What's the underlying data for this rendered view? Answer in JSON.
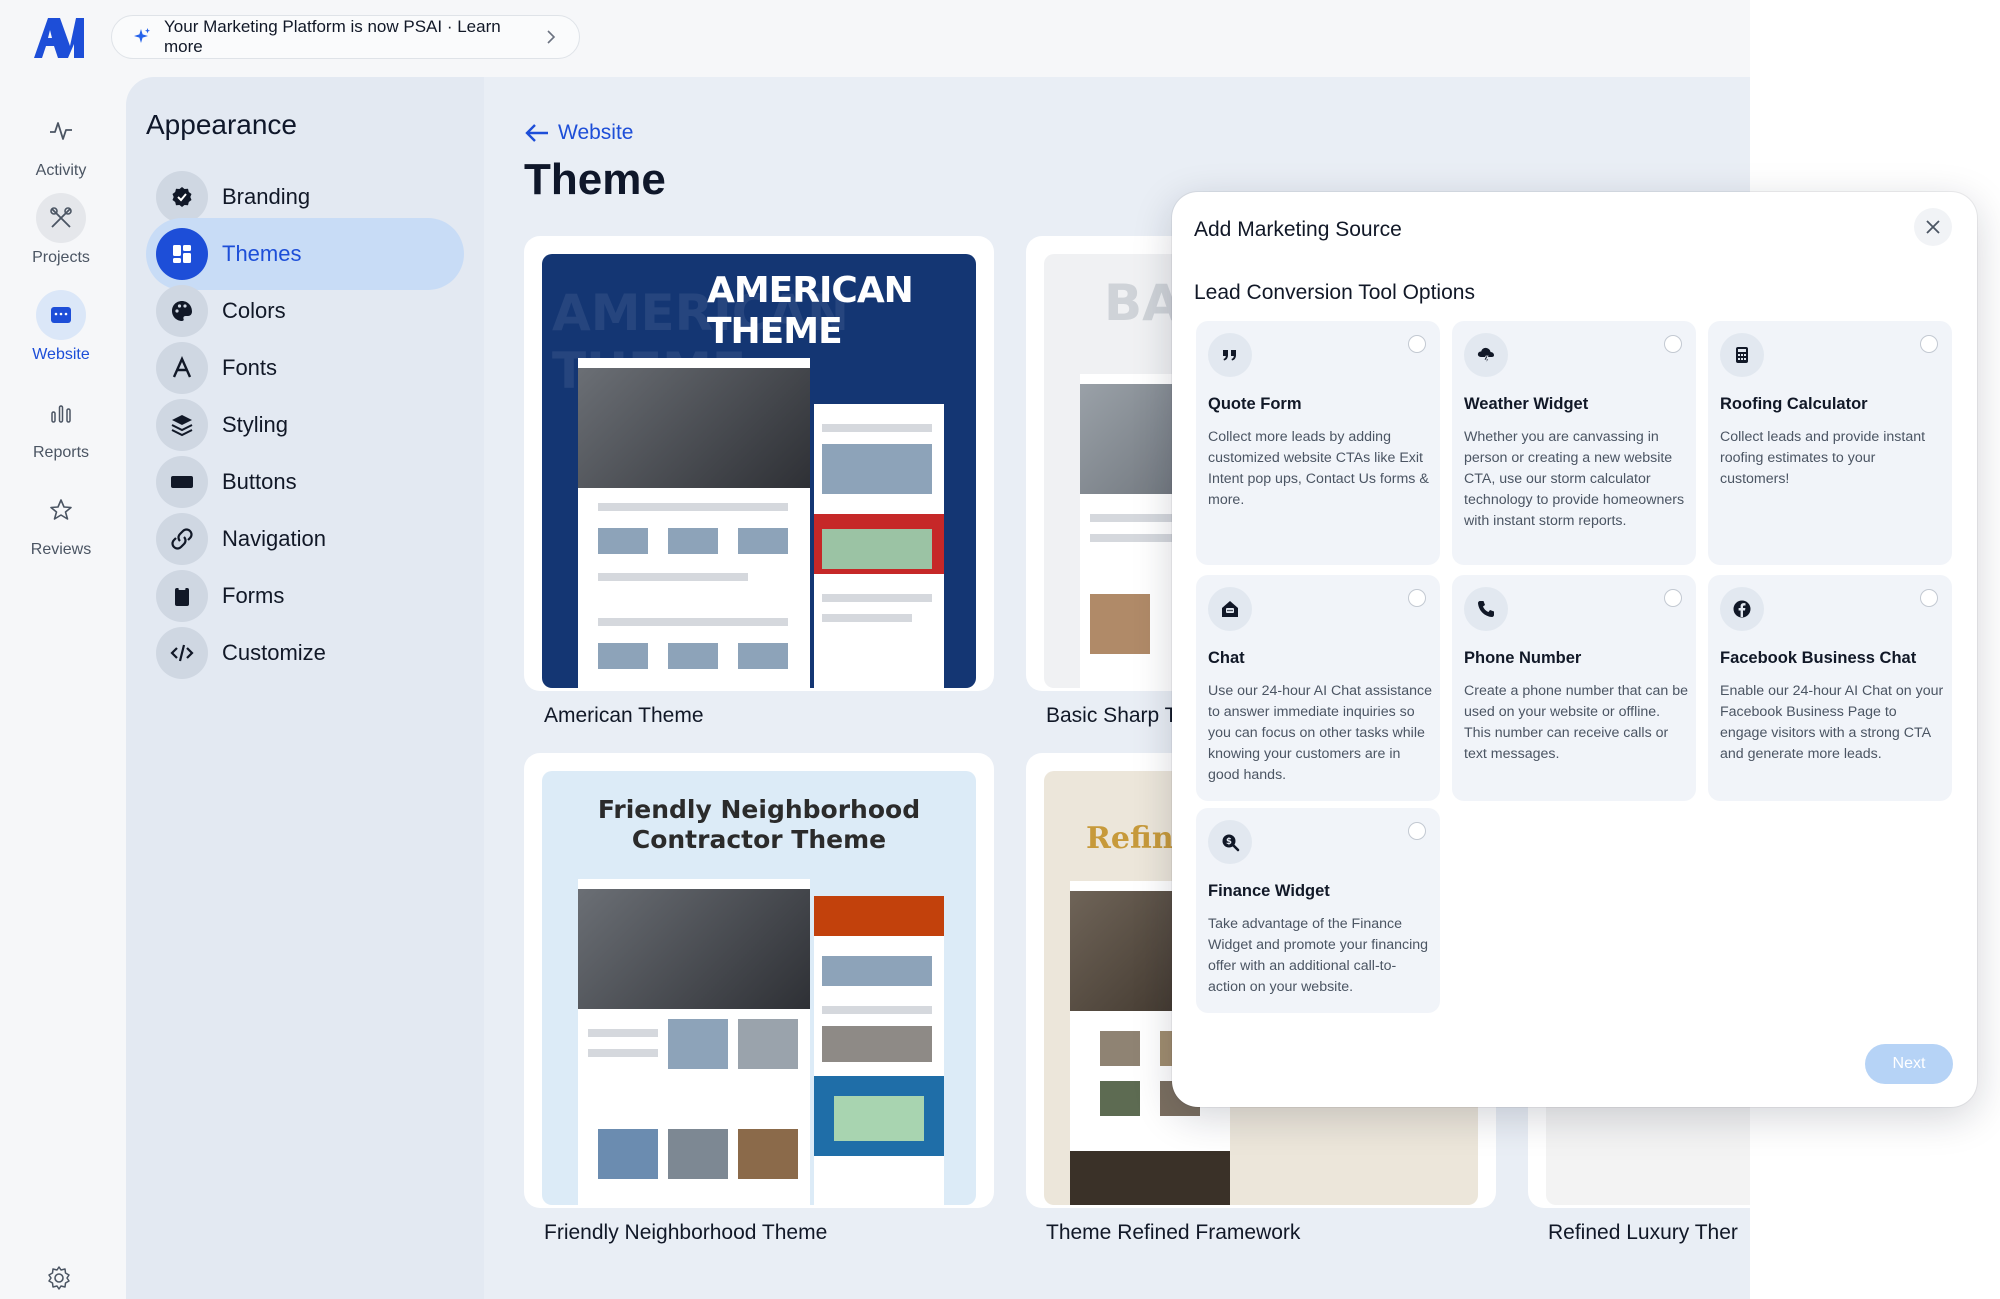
{
  "banner": {
    "text": "Your Marketing Platform is now PSAI · Learn more"
  },
  "rail": {
    "items": [
      {
        "label": "Activity",
        "icon": "activity-icon"
      },
      {
        "label": "Projects",
        "icon": "tools-icon"
      },
      {
        "label": "Website",
        "icon": "browser-icon"
      },
      {
        "label": "Reports",
        "icon": "bar-chart-icon"
      },
      {
        "label": "Reviews",
        "icon": "star-icon"
      }
    ],
    "active": "Website"
  },
  "appearance": {
    "title": "Appearance",
    "items": [
      {
        "label": "Branding",
        "icon": "badge-check-icon"
      },
      {
        "label": "Themes",
        "icon": "layout-icon"
      },
      {
        "label": "Colors",
        "icon": "palette-icon"
      },
      {
        "label": "Fonts",
        "icon": "font-icon"
      },
      {
        "label": "Styling",
        "icon": "layers-icon"
      },
      {
        "label": "Buttons",
        "icon": "button-icon"
      },
      {
        "label": "Navigation",
        "icon": "link-icon"
      },
      {
        "label": "Forms",
        "icon": "clipboard-icon"
      },
      {
        "label": "Customize",
        "icon": "code-icon"
      }
    ],
    "active": "Themes"
  },
  "main": {
    "back_label": "Website",
    "title": "Theme",
    "themes": [
      {
        "label": "American Theme",
        "banner_text": "AMERICAN THEME",
        "ghost_text": "AMERICAN THEME"
      },
      {
        "label": "Basic Sharp T",
        "banner_text": "BA"
      },
      {
        "label": "Friendly Neighborhood Theme",
        "banner_text": "Friendly Neighborhood Contractor Theme"
      },
      {
        "label": "Theme Refined Framework",
        "banner_text": "Refine"
      },
      {
        "label": "Refined Luxury Ther"
      }
    ]
  },
  "modal": {
    "title": "Add Marketing Source",
    "subtitle": "Lead Conversion Tool Options",
    "options": [
      {
        "name": "Quote Form",
        "icon": "quote-icon",
        "desc": "Collect more leads by adding customized website CTAs like Exit Intent pop ups, Contact Us forms & more."
      },
      {
        "name": "Weather Widget",
        "icon": "storm-cloud-icon",
        "desc": "Whether you are canvassing in person or creating a new website CTA, use our storm calculator technology to provide homeowners with instant storm reports."
      },
      {
        "name": "Roofing Calculator",
        "icon": "calculator-icon",
        "desc": "Collect leads and provide instant roofing estimates to your customers!"
      },
      {
        "name": "Chat",
        "icon": "home-chat-icon",
        "desc": "Use our 24-hour AI Chat assistance to answer immediate inquiries so you can focus on other tasks while knowing your customers are in good hands."
      },
      {
        "name": "Phone Number",
        "icon": "phone-icon",
        "desc": "Create a phone number that can be used on your website or offline. This number can receive calls or text messages."
      },
      {
        "name": "Facebook Business Chat",
        "icon": "facebook-icon",
        "desc": "Enable our 24-hour AI Chat on your Facebook Business Page to engage visitors with a strong CTA and generate more leads."
      },
      {
        "name": "Finance Widget",
        "icon": "finance-search-icon",
        "desc": "Take advantage of the Finance Widget and promote your financing offer with an additional call-to-action on your website."
      }
    ],
    "next_label": "Next"
  },
  "colors": {
    "accent": "#1d4ed8",
    "next_disabled": "#b6d3f6"
  }
}
